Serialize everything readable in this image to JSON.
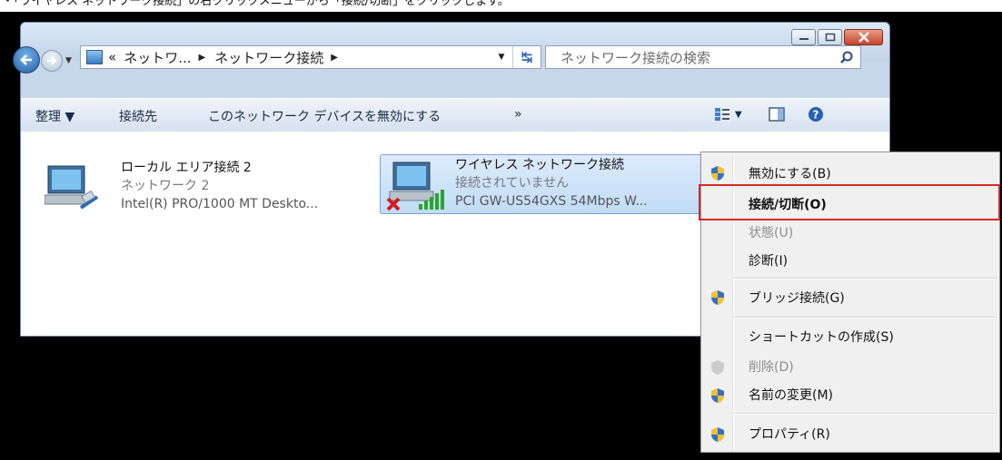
{
  "caption": "・「ワイヤレス ネットワーク接続」の右クリックメニューから「接続/切断」をクリックします。",
  "address": {
    "overflow": "«",
    "segments": [
      "ネットワ...",
      "ネットワーク接続"
    ]
  },
  "search": {
    "placeholder": "ネットワーク接続の検索"
  },
  "toolbar": {
    "organize": "整理 ▼",
    "connect_to": "接続先",
    "disable_device": "このネットワーク デバイスを無効にする",
    "more": "»"
  },
  "connections": [
    {
      "name": "ローカル エリア接続 2",
      "status": "ネットワーク 2",
      "device": "Intel(R) PRO/1000 MT Deskto..."
    },
    {
      "name": "ワイヤレス ネットワーク接続",
      "status": "接続されていません",
      "device": "PCI GW-US54GXS 54Mbps W..."
    }
  ],
  "context_menu": [
    {
      "label": "無効にする(B)"
    },
    {
      "label": "接続/切断(O)"
    },
    {
      "label": "状態(U)"
    },
    {
      "label": "診断(I)"
    },
    {
      "label": "ブリッジ接続(G)"
    },
    {
      "label": "ショートカットの作成(S)"
    },
    {
      "label": "削除(D)"
    },
    {
      "label": "名前の変更(M)"
    },
    {
      "label": "プロパティ(R)"
    }
  ],
  "colors": {
    "highlight_border": "#d72828",
    "selection_bg": "#c1dcf7"
  }
}
